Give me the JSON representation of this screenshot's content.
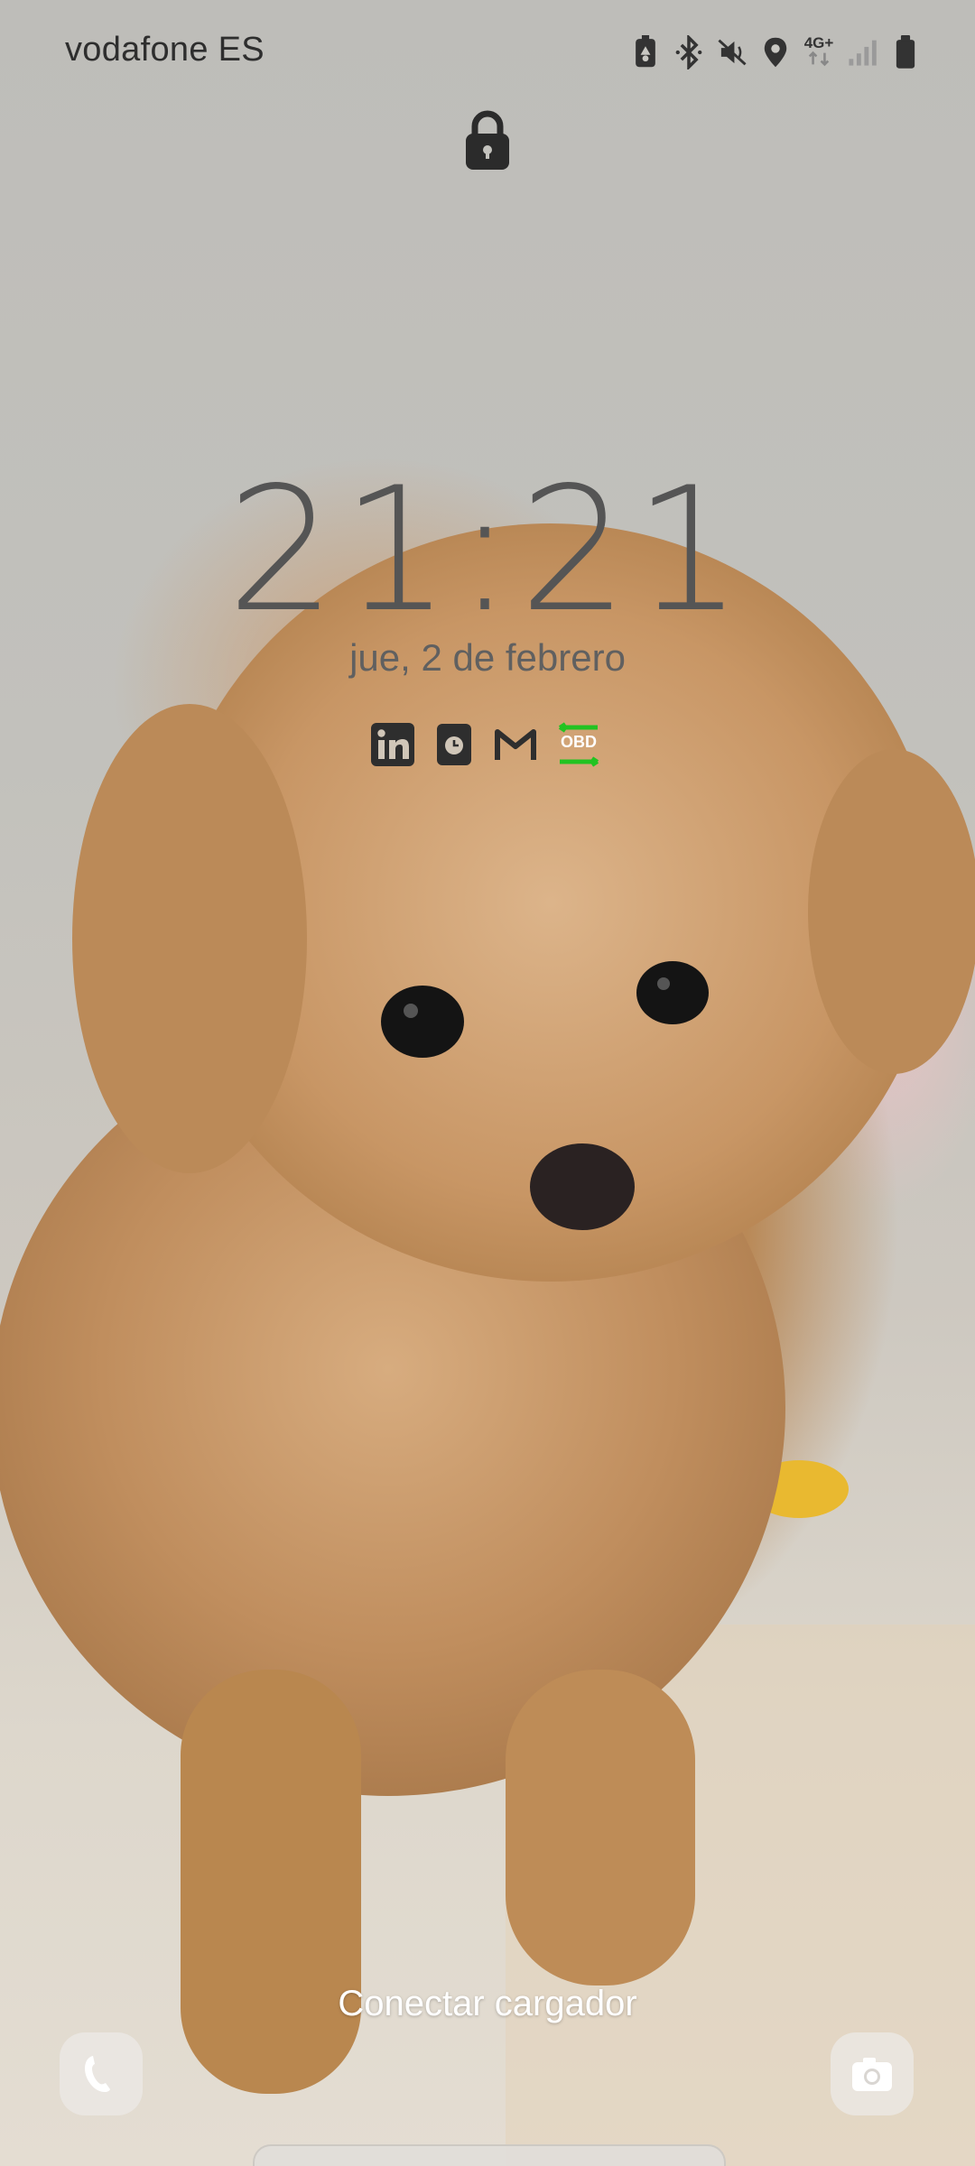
{
  "status_bar": {
    "carrier": "vodafone ES",
    "network_type": "4G+",
    "icons": [
      "battery-saver-icon",
      "bluetooth-icon",
      "vibrate-mute-icon",
      "location-icon",
      "network-4g-icon",
      "signal-icon",
      "battery-icon"
    ]
  },
  "lock_screen": {
    "lock_icon": "lock-icon",
    "time": "21:21",
    "date": "jue, 2 de febrero",
    "notification_icons": [
      "linkedin-icon",
      "clock-app-icon",
      "gmail-icon",
      "obd-icon"
    ],
    "obd_label": "OBD",
    "charger_hint": "Conectar cargador"
  },
  "shortcuts": {
    "left": "phone-icon",
    "right": "camera-icon"
  },
  "colors": {
    "obd_accent": "#22c322",
    "text_dark": "#2e2e2e"
  }
}
